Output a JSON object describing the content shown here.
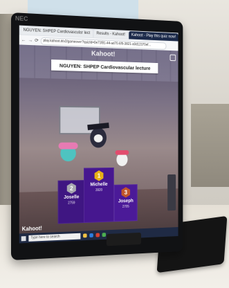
{
  "monitor": {
    "brand": "NEC"
  },
  "browser": {
    "tabs": [
      {
        "label": "NGUYEN: SHPEP Cardiovascular lect",
        "style": "plain"
      },
      {
        "label": "Results - Kahoot!",
        "style": "plain"
      },
      {
        "label": "Kahoot - Play this quiz now!",
        "style": "dark"
      }
    ],
    "url": "play.kahoot.it/v2/gameover?quizId=0e71f81-44-ad70-6f9-3821-a0d12370ef..."
  },
  "kahoot": {
    "logo": "Kahoot!",
    "title": "NGUYEN: SHPEP Cardiovascular lecture",
    "podium": [
      {
        "rank": "1",
        "name": "Michelle",
        "score": "3920"
      },
      {
        "rank": "2",
        "name": "Joselle",
        "score": "2759"
      },
      {
        "rank": "3",
        "name": "Joseph",
        "score": "2705"
      }
    ],
    "bottom_logo": "Kahoot!"
  },
  "taskbar": {
    "search_placeholder": "Type here to search"
  },
  "colors": {
    "podium": "#46178f",
    "gold": "#e6b117",
    "silver": "#a8a8b0",
    "bronze": "#c2562a",
    "taskbar": "#1f2a44"
  }
}
